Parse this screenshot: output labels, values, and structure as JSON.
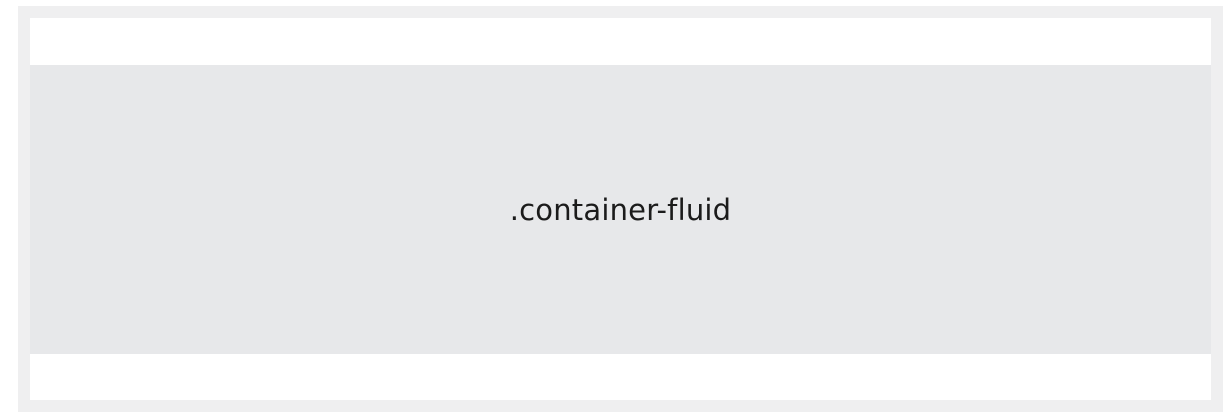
{
  "demo": {
    "label": ".container-fluid"
  }
}
